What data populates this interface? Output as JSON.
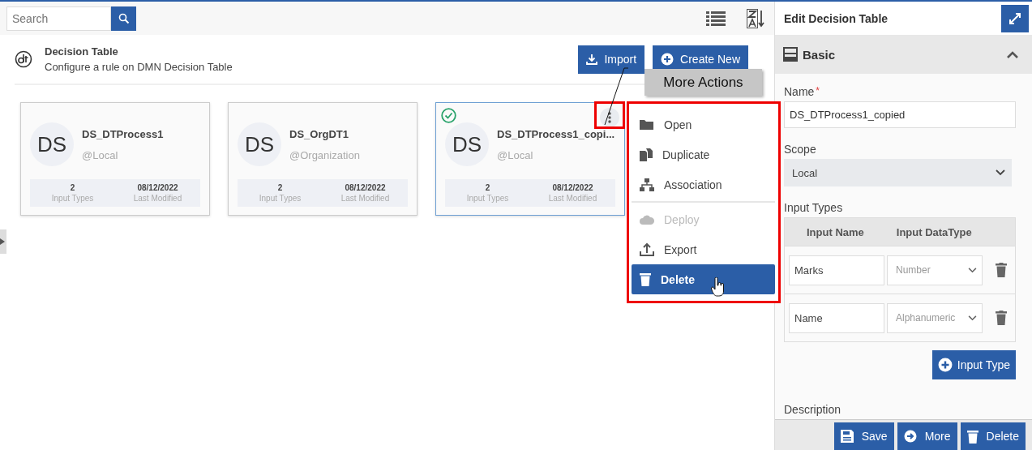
{
  "search": {
    "placeholder": "Search"
  },
  "header": {
    "title": "Decision Table",
    "subtitle": "Configure a rule on DMN Decision Table",
    "buttons": [
      {
        "label": "Import",
        "kind": "import"
      },
      {
        "label": "Create New",
        "kind": "create"
      }
    ]
  },
  "cards": [
    {
      "initials": "DS",
      "name": "DS_DTProcess1",
      "scope": "@Local",
      "count": "2",
      "count_label": "Input Types",
      "modified": "08/12/2022",
      "modified_label": "Last Modified",
      "selected": false
    },
    {
      "initials": "DS",
      "name": "DS_OrgDT1",
      "scope": "@Organization",
      "count": "2",
      "count_label": "Input Types",
      "modified": "08/12/2022",
      "modified_label": "Last Modified",
      "selected": false
    },
    {
      "initials": "DS",
      "name": "DS_DTProcess1_copi...",
      "scope": "@Local",
      "count": "2",
      "count_label": "Input Types",
      "modified": "08/12/2022",
      "modified_label": "Last Modified",
      "selected": true
    }
  ],
  "callout": "More Actions",
  "menu": [
    {
      "label": "Open",
      "kind": "folder",
      "disabled": false,
      "selected": false,
      "separator_before": false
    },
    {
      "label": "Duplicate",
      "kind": "copy",
      "disabled": false,
      "selected": false,
      "separator_before": false
    },
    {
      "label": "Association",
      "kind": "tree",
      "disabled": false,
      "selected": false,
      "separator_before": false
    },
    {
      "label": "Deploy",
      "kind": "cloud",
      "disabled": true,
      "selected": false,
      "separator_before": true
    },
    {
      "label": "Export",
      "kind": "upload",
      "disabled": false,
      "selected": false,
      "separator_before": false
    },
    {
      "label": "Delete",
      "kind": "trash",
      "disabled": false,
      "selected": true,
      "separator_before": false
    }
  ],
  "panel": {
    "title": "Edit Decision Table",
    "section": "Basic",
    "expanded": true,
    "name_label": "Name",
    "required_mark": "*",
    "name_value": "DS_DTProcess1_copied",
    "scope_label": "Scope",
    "scope_value": "Local",
    "input_types_label": "Input Types",
    "columns": [
      "Input Name",
      "Input DataType"
    ],
    "rows": [
      {
        "name": "Marks",
        "type": "Number"
      },
      {
        "name": "Name",
        "type": "Alphanumeric"
      }
    ],
    "add_button": "Input Type",
    "description_label": "Description"
  },
  "footer": [
    {
      "label": "Save",
      "kind": "save"
    },
    {
      "label": "More",
      "kind": "more"
    },
    {
      "label": "Delete",
      "kind": "delete"
    }
  ]
}
